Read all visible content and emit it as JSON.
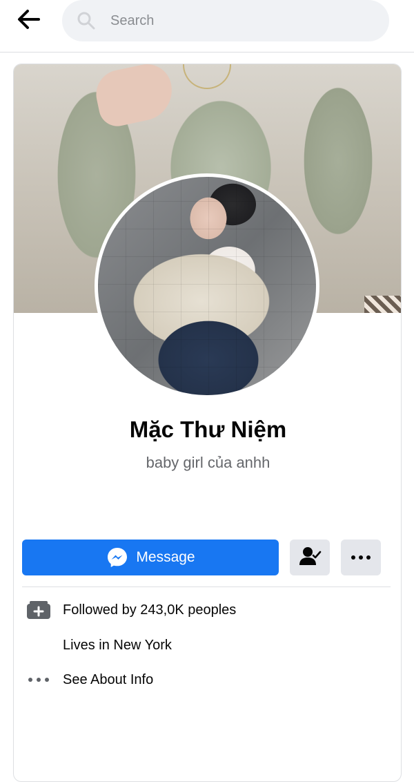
{
  "search": {
    "placeholder": "Search"
  },
  "profile": {
    "name": "Mặc Thư Niệm",
    "bio": "baby girl của anhh"
  },
  "actions": {
    "message_label": "Message"
  },
  "info": {
    "followers": "Followed by 243,0K peoples",
    "location": "Lives in New York",
    "about": "See About Info"
  },
  "colors": {
    "primary_blue": "#1877f2",
    "secondary_button": "#e4e6eb",
    "search_bg": "#f0f2f5",
    "secondary_text": "#65676b"
  },
  "icons": {
    "back": "arrow-left-icon",
    "search": "search-icon",
    "messenger": "messenger-icon",
    "friend": "friend-check-icon",
    "more": "more-dots-icon",
    "followers": "followers-icon",
    "about": "more-dots-icon"
  }
}
